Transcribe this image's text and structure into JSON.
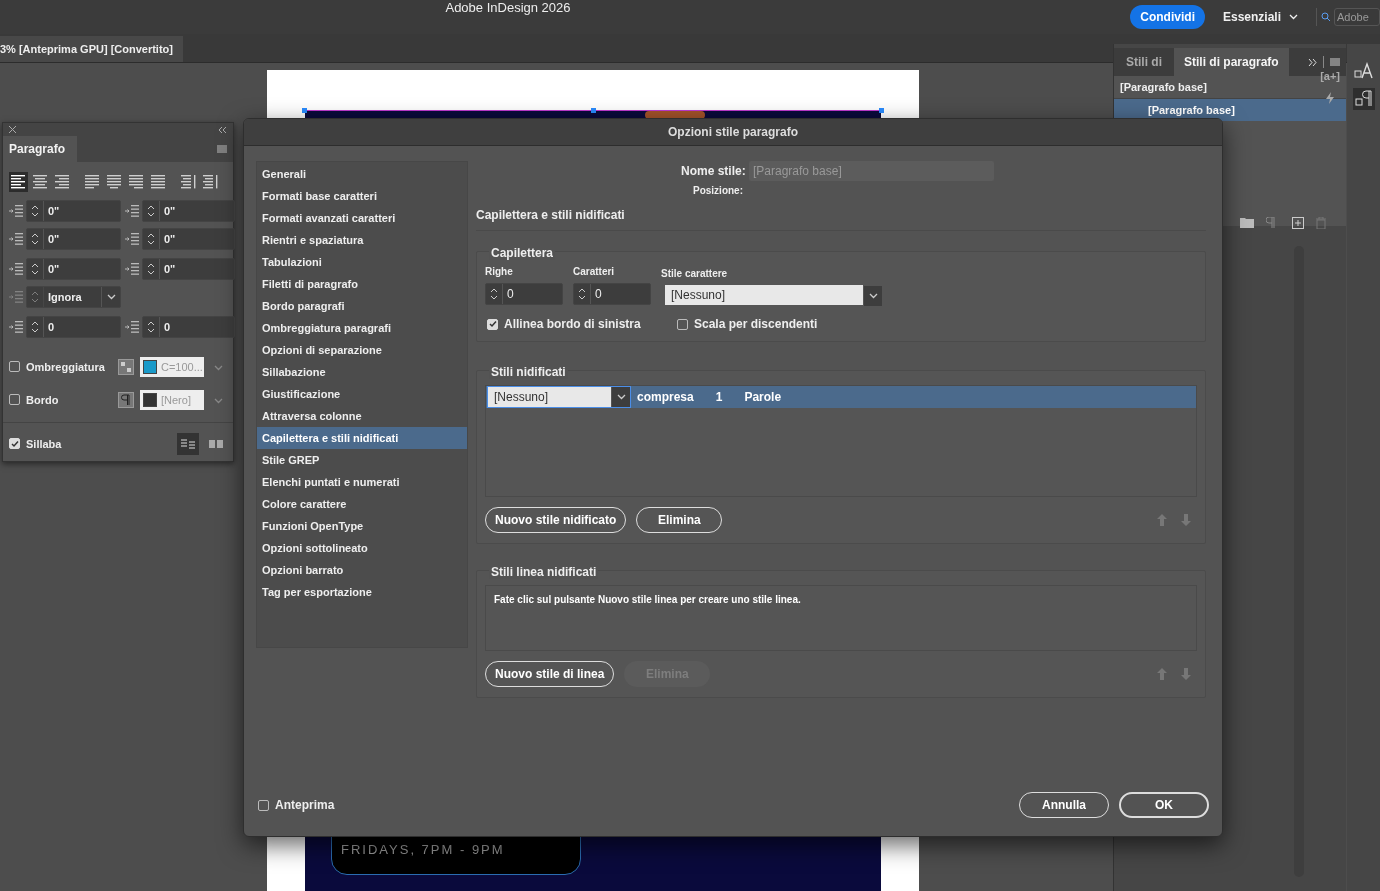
{
  "app": {
    "title": "Adobe InDesign 2026",
    "share_button": "Condividi",
    "workspace": "Essenziali",
    "search": {
      "placeholder": "Adobe"
    }
  },
  "document_tab": {
    "label": "3% [Anteprima GPU] [Convertito]"
  },
  "document": {
    "caption": "FRIDAYS, 7PM - 9PM"
  },
  "paragraph_panel": {
    "title": "Paragrafo",
    "alignments": [
      {
        "kind": "left",
        "selected": true
      },
      {
        "kind": "center",
        "selected": false
      },
      {
        "kind": "right",
        "selected": false
      },
      {
        "kind": "justify-left",
        "selected": false
      },
      {
        "kind": "justify-center",
        "selected": false
      },
      {
        "kind": "justify-right",
        "selected": false
      },
      {
        "kind": "justify-all",
        "selected": false
      },
      {
        "kind": "toward-spine",
        "selected": false
      },
      {
        "kind": "away-spine",
        "selected": false
      }
    ],
    "rows": [
      {
        "fields": [
          {
            "kind": "left-indent",
            "value": "0\""
          },
          {
            "kind": "right-indent",
            "value": "0\""
          }
        ]
      },
      {
        "fields": [
          {
            "kind": "first-line-indent",
            "value": "0\""
          },
          {
            "kind": "last-line-indent",
            "value": "0\""
          }
        ]
      },
      {
        "fields": [
          {
            "kind": "space-before",
            "value": "0\""
          },
          {
            "kind": "space-after",
            "value": "0\""
          }
        ]
      },
      {
        "fields": [
          {
            "kind": "grid-align",
            "value": "Ignora",
            "disabled": true
          }
        ]
      },
      {
        "fields": [
          {
            "kind": "drop-cap-lines",
            "value": "0"
          },
          {
            "kind": "drop-cap-chars",
            "value": "0"
          }
        ]
      }
    ],
    "swatch_rows": [
      {
        "label": "Ombreggiatura",
        "checked": false,
        "swatch": "C=100...",
        "color": "#1a9ac9"
      },
      {
        "label": "Bordo",
        "checked": false,
        "swatch": "[Nero]",
        "color": "#333333"
      }
    ],
    "hyphenate": {
      "label": "Sillaba",
      "checked": true
    }
  },
  "styles_panel": {
    "tabs": [
      {
        "label": "Stili di",
        "selected": false
      },
      {
        "label": "Stili di paragrafo",
        "selected": true
      }
    ],
    "current": "[Paragrafo base]",
    "new_style": "[a+]",
    "items": [
      {
        "label": "[Paragrafo base]",
        "selected": true
      }
    ]
  },
  "dialog": {
    "title": "Opzioni stile paragrafo",
    "categories": [
      {
        "label": "Generali",
        "selected": false
      },
      {
        "label": "Formati base caratteri",
        "selected": false
      },
      {
        "label": "Formati avanzati caratteri",
        "selected": false
      },
      {
        "label": "Rientri e spaziatura",
        "selected": false
      },
      {
        "label": "Tabulazioni",
        "selected": false
      },
      {
        "label": "Filetti di paragrafo",
        "selected": false
      },
      {
        "label": "Bordo paragrafi",
        "selected": false
      },
      {
        "label": "Ombreggiatura paragrafi",
        "selected": false
      },
      {
        "label": "Opzioni di separazione",
        "selected": false
      },
      {
        "label": "Sillabazione",
        "selected": false
      },
      {
        "label": "Giustificazione",
        "selected": false
      },
      {
        "label": "Attraversa colonne",
        "selected": false
      },
      {
        "label": "Capilettera e stili nidificati",
        "selected": true
      },
      {
        "label": "Stile GREP",
        "selected": false
      },
      {
        "label": "Elenchi puntati e numerati",
        "selected": false
      },
      {
        "label": "Colore carattere",
        "selected": false
      },
      {
        "label": "Funzioni OpenType",
        "selected": false
      },
      {
        "label": "Opzioni sottolineato",
        "selected": false
      },
      {
        "label": "Opzioni barrato",
        "selected": false
      },
      {
        "label": "Tag per esportazione",
        "selected": false
      }
    ],
    "style_name": {
      "label": "Nome stile:",
      "value": "[Paragrafo base]",
      "disabled": true
    },
    "position_label": "Posizione:",
    "section_title": "Capilettera e stili nidificati",
    "drop_caps": {
      "title": "Capilettera",
      "lines": {
        "label": "Righe",
        "value": "0"
      },
      "chars": {
        "label": "Caratteri",
        "value": "0"
      },
      "char_style": {
        "label": "Stile carattere",
        "value": "[Nessuno]"
      },
      "options": [
        {
          "label": "Allinea bordo di sinistra",
          "checked": true
        },
        {
          "label": "Scala per discendenti",
          "checked": false
        }
      ]
    },
    "nested_styles": {
      "title": "Stili nidificati",
      "rows": [
        {
          "style": "[Nessuno]",
          "mode": "compresa",
          "count": "1",
          "unit": "Parole",
          "selected": true
        }
      ],
      "buttons": [
        {
          "label": "Nuovo stile nidificato",
          "disabled": false
        },
        {
          "label": "Elimina",
          "disabled": false
        }
      ]
    },
    "nested_line_styles": {
      "title": "Stili linea nidificati",
      "message": "Fate clic sul pulsante Nuovo stile linea per creare uno stile linea.",
      "buttons": [
        {
          "label": "Nuovo stile di linea",
          "disabled": false
        },
        {
          "label": "Elimina",
          "disabled": true
        }
      ]
    },
    "preview": {
      "label": "Anteprima",
      "checked": false
    },
    "buttons": [
      {
        "label": "Annulla",
        "kind": "secondary"
      },
      {
        "label": "OK",
        "kind": "default"
      }
    ]
  }
}
